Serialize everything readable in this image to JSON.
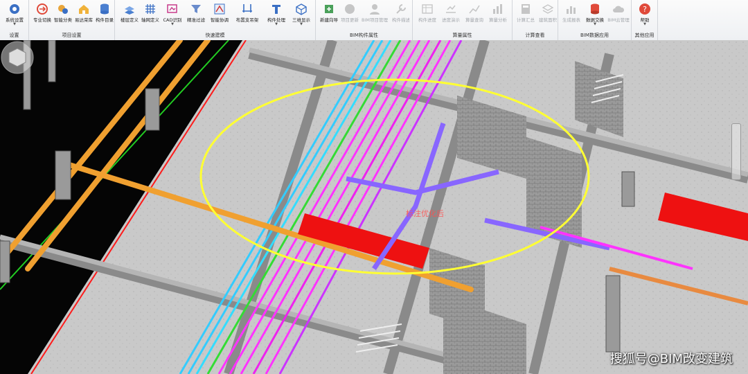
{
  "ribbon": {
    "groups": [
      {
        "label": "设置"
      },
      {
        "label": "项目设置"
      },
      {
        "label": "快速建模"
      },
      {
        "label": "BIM构件属性"
      },
      {
        "label": "算量属性"
      },
      {
        "label": "计算查看"
      },
      {
        "label": "BIM数据应用"
      },
      {
        "label": "其他应用"
      }
    ],
    "buttons": {
      "system_settings": "系统设置",
      "switch_discipline": "专业切换",
      "smart_classify": "智能分类",
      "easy_library": "易达荣库",
      "component_catalog": "构件目录",
      "floor_define": "楼层定义",
      "axis_define": "轴网定义",
      "cad_recognize": "CAD识别",
      "precise_filter": "精准过滤",
      "smart_coordinate": "智能协调",
      "support_hanger": "布置支吊架",
      "component_process": "构件处理",
      "view_3d": "三维显示",
      "new_wizard": "新建向导",
      "project_update": "项目更新",
      "bim_project_manage": "BIM项目管理",
      "component_desc": "构件描述",
      "component_progress": "构件进度",
      "progress_simulation": "进度演示",
      "attribute_query": "算量查询",
      "attribute_analysis": "算量分析",
      "calc_summary": "计算汇总",
      "build_view": "建筑面积",
      "generate_report": "生成报表",
      "data_exchange": "数据交换",
      "bim_cloud": "BIM云管理",
      "help": "帮助"
    }
  },
  "viewport": {
    "overlay_text": "标注优化后",
    "watermark": "搜狐号@BIM改变建筑"
  },
  "colors": {
    "ribbon_bg": "#f4f5f7",
    "highlight_ellipse": "#ffff33",
    "pipe_orange": "#f0a030",
    "pipe_magenta": "#ff33ff",
    "pipe_cyan": "#33ccff",
    "pipe_green": "#33dd33",
    "duct_red": "#ee1111",
    "pipe_purple": "#8866ff"
  }
}
